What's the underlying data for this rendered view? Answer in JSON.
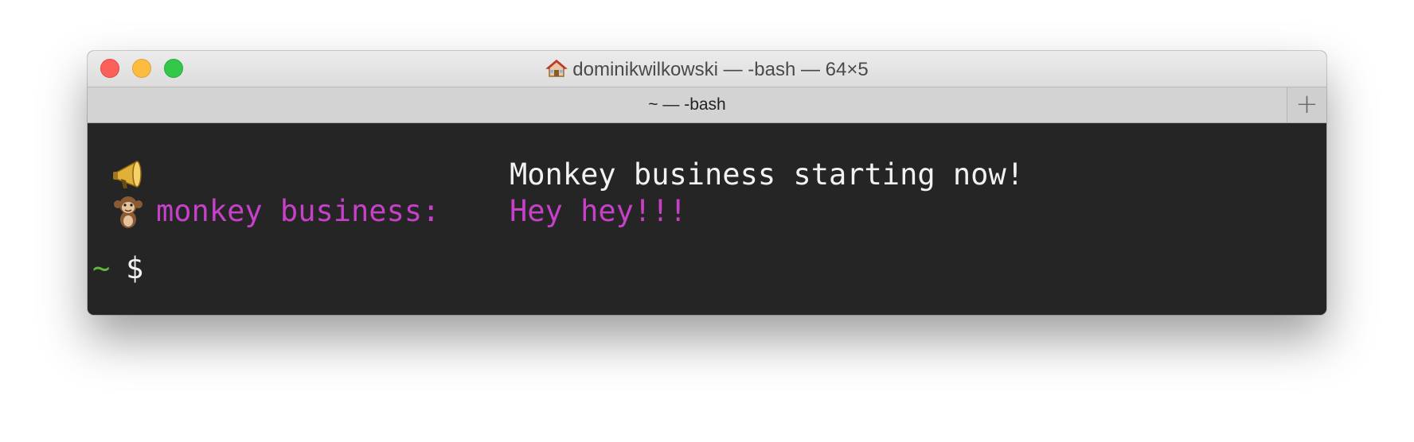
{
  "window": {
    "title": "dominikwilkowski — -bash — 64×5",
    "title_icon": "home-icon",
    "tab_label": "~ — -bash",
    "new_tab_label": "+"
  },
  "terminal": {
    "line1": {
      "icon": "megaphone-icon",
      "text": "Monkey business starting now!"
    },
    "line2": {
      "icon": "monkey-icon",
      "label": "monkey business:",
      "message": "Hey hey!!!"
    },
    "prompt": {
      "path": "~",
      "symbol": "$"
    }
  },
  "colors": {
    "background": "#252525",
    "text": "#f2f2f2",
    "magenta": "#c640c8",
    "prompt_green": "#5fba3a",
    "traffic_close": "#fc605b",
    "traffic_minimize": "#fdbc40",
    "traffic_zoom": "#34c84a"
  }
}
